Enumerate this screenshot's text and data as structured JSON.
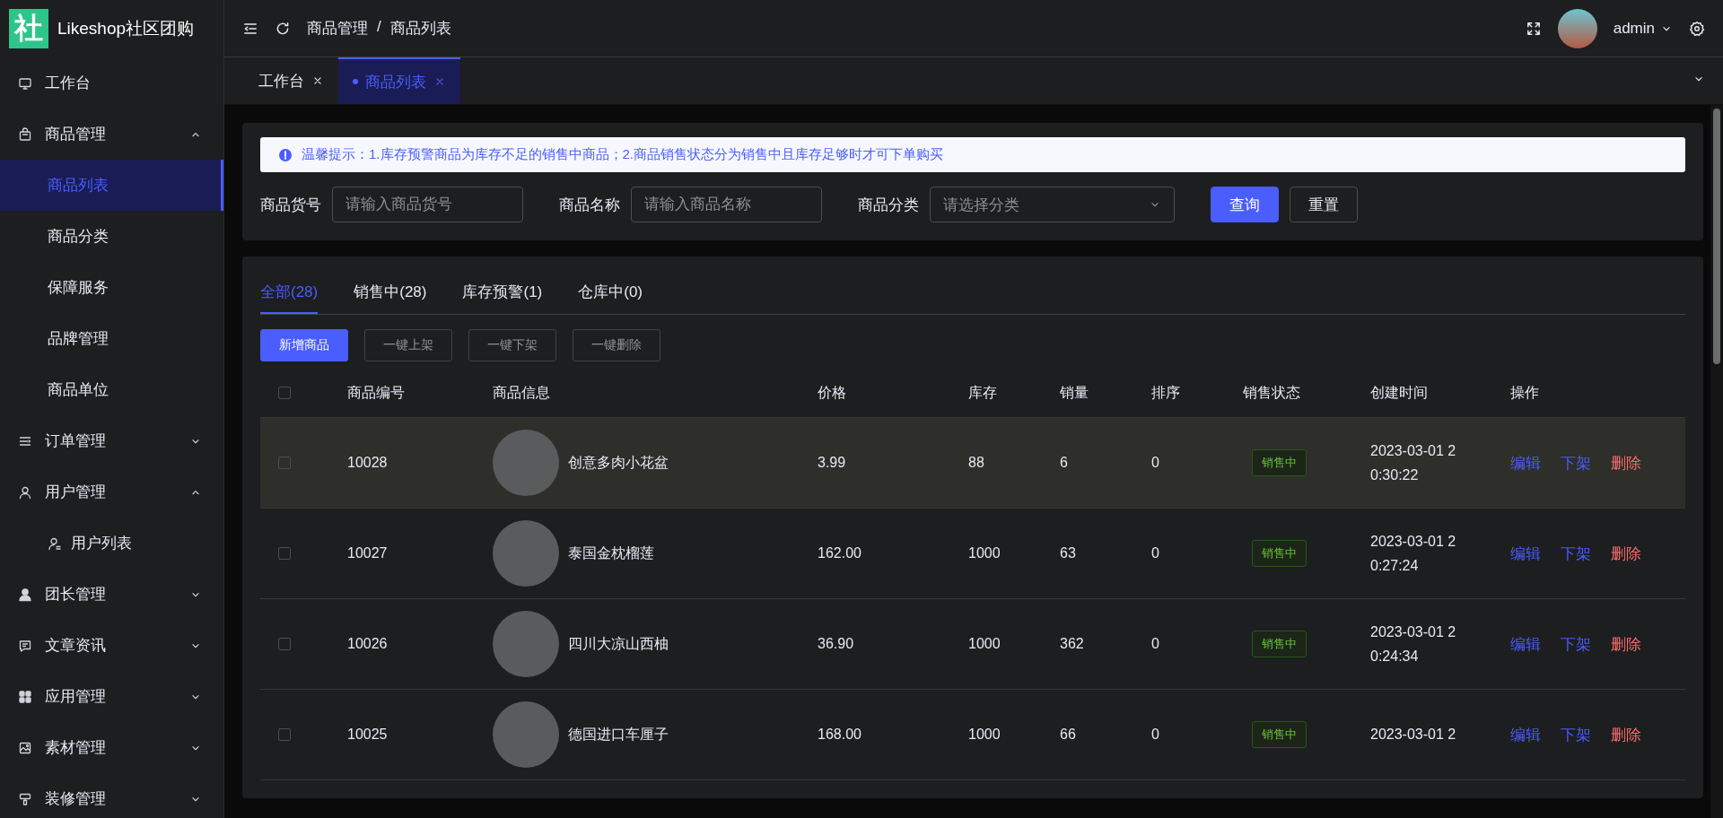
{
  "brand": {
    "logo": "社",
    "name": "Likeshop社区团购"
  },
  "sidebar": {
    "items": [
      {
        "label": "工作台",
        "selected": false
      },
      {
        "label": "商品管理",
        "expanded": true,
        "children": [
          {
            "label": "商品列表",
            "selected": true
          },
          {
            "label": "商品分类",
            "selected": false
          },
          {
            "label": "保障服务",
            "selected": false
          },
          {
            "label": "品牌管理",
            "selected": false
          },
          {
            "label": "商品单位",
            "selected": false
          }
        ]
      },
      {
        "label": "订单管理",
        "expanded": false
      },
      {
        "label": "用户管理",
        "expanded": true,
        "children": [
          {
            "label": "用户列表",
            "selected": false
          }
        ]
      },
      {
        "label": "团长管理",
        "expanded": false
      },
      {
        "label": "文章资讯",
        "expanded": false
      },
      {
        "label": "应用管理",
        "expanded": false
      },
      {
        "label": "素材管理",
        "expanded": false
      },
      {
        "label": "装修管理",
        "expanded": false
      }
    ]
  },
  "header": {
    "breadcrumb": [
      "商品管理",
      "商品列表"
    ],
    "breadcrumb_separator": "/",
    "user": "admin"
  },
  "tabs": [
    {
      "label": "工作台",
      "selected": false
    },
    {
      "label": "商品列表",
      "selected": true
    }
  ],
  "notice": "温馨提示：1.库存预警商品为库存不足的销售中商品；2.商品销售状态分为销售中且库存足够时才可下单购买",
  "filters": [
    {
      "label": "商品货号",
      "kind": "input",
      "placeholder": "请输入商品货号"
    },
    {
      "label": "商品名称",
      "kind": "input",
      "placeholder": "请输入商品名称"
    },
    {
      "label": "商品分类",
      "kind": "select",
      "placeholder": "请选择分类"
    }
  ],
  "filter_buttons": [
    {
      "label": "查询",
      "kind": "primary"
    },
    {
      "label": "重置",
      "kind": "default"
    }
  ],
  "status_tabs": [
    {
      "label": "全部(28)",
      "selected": true
    },
    {
      "label": "销售中(28)",
      "selected": false
    },
    {
      "label": "库存预警(1)",
      "selected": false
    },
    {
      "label": "仓库中(0)",
      "selected": false
    }
  ],
  "actions": [
    {
      "label": "新增商品",
      "kind": "primary"
    },
    {
      "label": "一键上架",
      "kind": "default"
    },
    {
      "label": "一键下架",
      "kind": "default"
    },
    {
      "label": "一键删除",
      "kind": "default"
    }
  ],
  "table": {
    "all_checked": false,
    "columns": [
      "商品编号",
      "商品信息",
      "价格",
      "库存",
      "销量",
      "排序",
      "销售状态",
      "创建时间",
      "操作"
    ],
    "rows": [
      {
        "checked": false,
        "highlighted": true,
        "id": "10028",
        "name": "创意多肉小花盆",
        "price": "3.99",
        "stock": "88",
        "sales": "6",
        "sort": "0",
        "status": "销售中",
        "created": "2023-03-01 20:30:22",
        "actions": [
          {
            "label": "编辑",
            "kind": "link"
          },
          {
            "label": "下架",
            "kind": "link"
          },
          {
            "label": "删除",
            "kind": "danger"
          }
        ]
      },
      {
        "checked": false,
        "highlighted": false,
        "id": "10027",
        "name": "泰国金枕榴莲",
        "price": "162.00",
        "stock": "1000",
        "sales": "63",
        "sort": "0",
        "status": "销售中",
        "created": "2023-03-01 20:27:24",
        "actions": [
          {
            "label": "编辑",
            "kind": "link"
          },
          {
            "label": "下架",
            "kind": "link"
          },
          {
            "label": "删除",
            "kind": "danger"
          }
        ]
      },
      {
        "checked": false,
        "highlighted": false,
        "id": "10026",
        "name": "四川大凉山西柚",
        "price": "36.90",
        "stock": "1000",
        "sales": "362",
        "sort": "0",
        "status": "销售中",
        "created": "2023-03-01 20:24:34",
        "actions": [
          {
            "label": "编辑",
            "kind": "link"
          },
          {
            "label": "下架",
            "kind": "link"
          },
          {
            "label": "删除",
            "kind": "danger"
          }
        ]
      },
      {
        "checked": false,
        "highlighted": false,
        "id": "10025",
        "name": "德国进口车厘子",
        "price": "168.00",
        "stock": "1000",
        "sales": "66",
        "sort": "0",
        "status": "销售中",
        "created": "2023-03-01 2",
        "actions": [
          {
            "label": "编辑",
            "kind": "link"
          },
          {
            "label": "下架",
            "kind": "link"
          },
          {
            "label": "删除",
            "kind": "danger"
          }
        ]
      }
    ]
  }
}
